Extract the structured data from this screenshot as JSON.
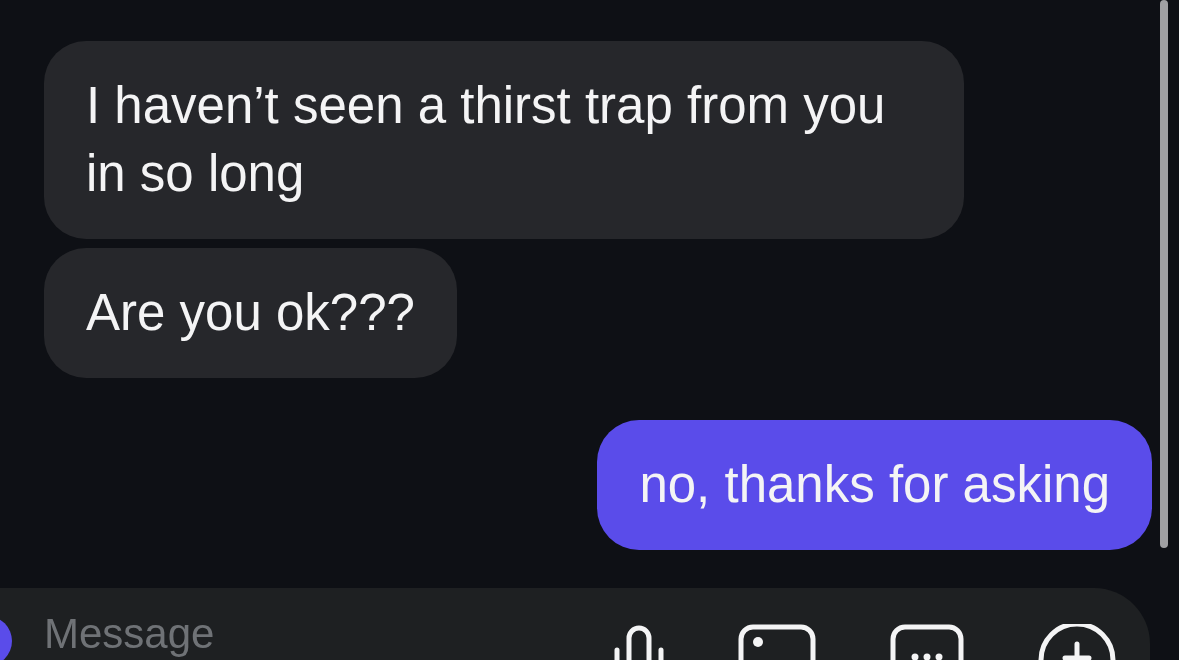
{
  "messages": [
    {
      "text": "I haven’t seen a thirst trap from you in so long",
      "outgoing": false
    },
    {
      "text": "Are you ok???",
      "outgoing": false
    },
    {
      "text": "no, thanks for asking",
      "outgoing": true
    }
  ],
  "composer": {
    "placeholder": "Message"
  }
}
